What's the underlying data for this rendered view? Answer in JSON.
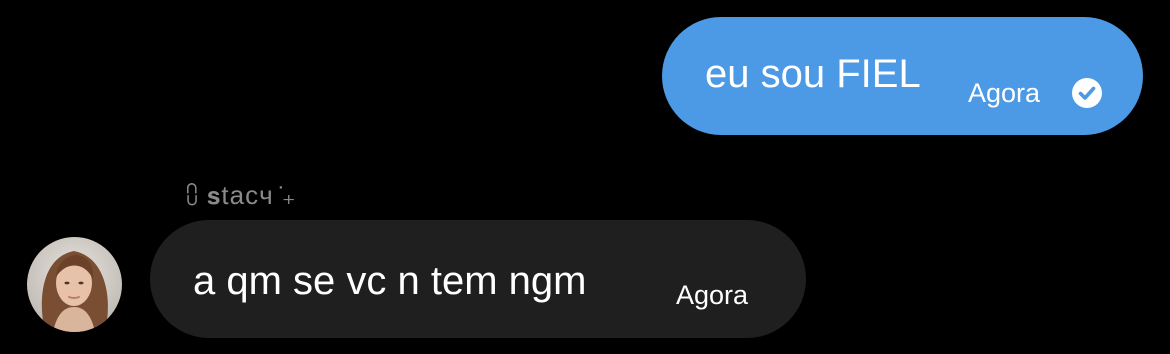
{
  "outgoing_message": {
    "text": "eu sou FIEL",
    "time": "Agora",
    "status_icon": "read-check-icon",
    "bubble_color": "#4c99e6"
  },
  "incoming_message": {
    "sender_name": "⩇ 𝘀tacч ̇₊",
    "text": "a qm se vc n tem ngm",
    "time": "Agora",
    "bubble_color": "#1f1f1f",
    "avatar_icon": "avatar"
  },
  "colors": {
    "background": "#000000",
    "sender_label": "#8a8a8a",
    "text": "#ffffff"
  }
}
